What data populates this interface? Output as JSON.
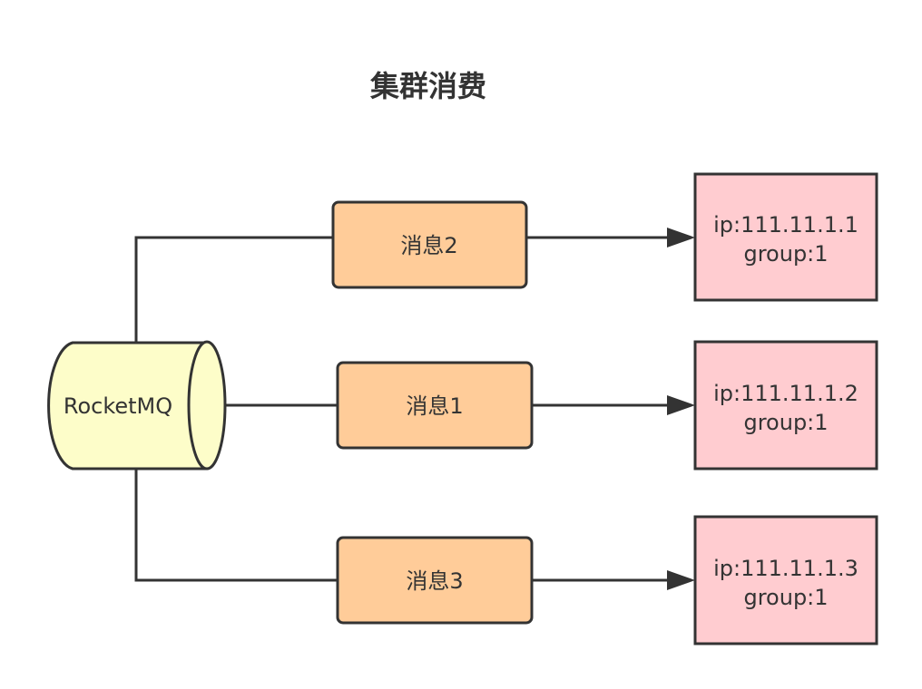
{
  "title": "集群消费",
  "broker": {
    "label": "RocketMQ",
    "fill": "#fdfdc9"
  },
  "messages": [
    {
      "label": "消息2"
    },
    {
      "label": "消息1"
    },
    {
      "label": "消息3"
    }
  ],
  "consumers": [
    {
      "ip": "ip:111.11.1.1",
      "group": "group:1"
    },
    {
      "ip": "ip:111.11.1.2",
      "group": "group:1"
    },
    {
      "ip": "ip:111.11.1.3",
      "group": "group:1"
    }
  ],
  "colors": {
    "message_fill": "#ffcc99",
    "consumer_fill": "#ffccd0",
    "stroke": "#333333"
  }
}
